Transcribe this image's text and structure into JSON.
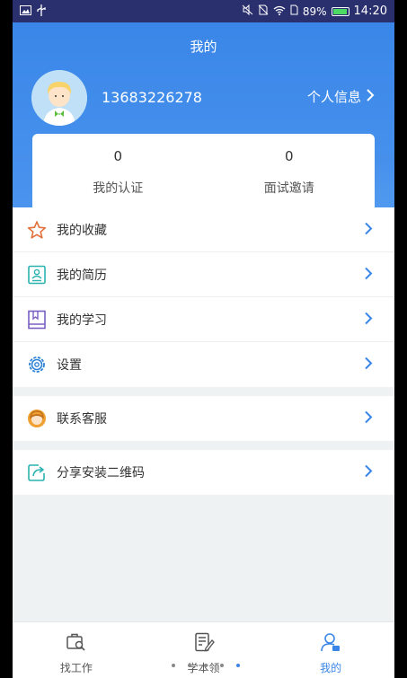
{
  "status_bar": {
    "battery": "89%",
    "time": "14:20"
  },
  "header": {
    "title": "我的",
    "phone": "13683226278",
    "profile_link": "个人信息"
  },
  "stats": [
    {
      "value": "0",
      "label": "我的认证"
    },
    {
      "value": "0",
      "label": "面试邀请"
    }
  ],
  "menu": {
    "group1": [
      {
        "label": "我的收藏",
        "icon": "star-icon"
      },
      {
        "label": "我的简历",
        "icon": "resume-icon"
      },
      {
        "label": "我的学习",
        "icon": "book-icon"
      },
      {
        "label": "设置",
        "icon": "gear-icon"
      }
    ],
    "group2": [
      {
        "label": "联系客服",
        "icon": "support-icon"
      }
    ],
    "group3": [
      {
        "label": "分享安装二维码",
        "icon": "share-icon"
      }
    ]
  },
  "tabbar": [
    {
      "label": "找工作",
      "icon": "job-search-icon",
      "active": false
    },
    {
      "label": "学本领",
      "icon": "edit-icon",
      "active": false
    },
    {
      "label": "我的",
      "icon": "user-icon",
      "active": true
    }
  ],
  "colors": {
    "primary": "#3a86e8",
    "star": "#e2703a",
    "teal": "#2bb3b0",
    "purple": "#7a5fc4",
    "blue": "#2f83d6",
    "orange": "#f0a030"
  }
}
